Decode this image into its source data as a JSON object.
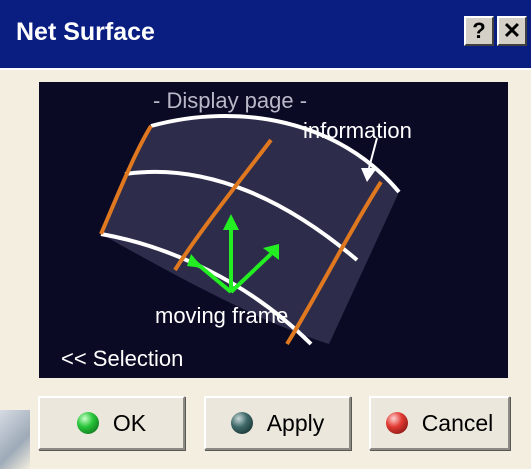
{
  "window": {
    "title": "Net Surface",
    "help_label": "?",
    "close_label": "✕"
  },
  "preview": {
    "display_page_label": "- Display page -",
    "information_label": "information",
    "moving_frame_label": "moving frame",
    "selection_label": "<< Selection"
  },
  "buttons": {
    "ok_label": "OK",
    "apply_label": "Apply",
    "cancel_label": "Cancel"
  },
  "icons": {
    "ok": "green-ball-icon",
    "apply": "dark-ball-icon",
    "cancel": "red-ball-icon",
    "help": "question-mark-icon",
    "close": "close-icon"
  },
  "colors": {
    "titlebar": "#0a1e82",
    "preview_bg": "#0a0a24",
    "guide_curve": "#ffffff",
    "profile_curve": "#e07820",
    "frame_arrows": "#22ee22"
  }
}
